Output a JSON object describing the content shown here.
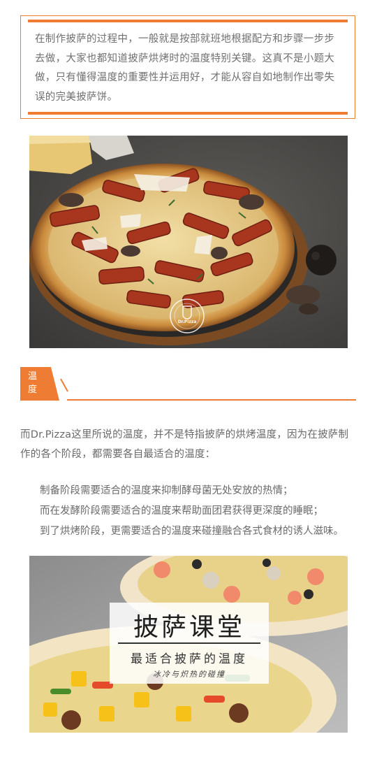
{
  "intro": {
    "text": "在制作披萨的过程中，一般就是按部就班地根据配方和步骤一步步去做，大家也都知道披萨烘烤时的温度特别关键。这真不是小题大做，只有懂得温度的重要性并运用好，才能从容自如地制作出零失误的完美披萨饼。"
  },
  "pizza_photo": {
    "watermark_text": "Dr.Pizza"
  },
  "section": {
    "tag": "温度"
  },
  "body": {
    "paragraph": "而Dr.Pizza这里所说的温度，并不是特指披萨的烘烤温度，因为在披萨制作的各个阶段，都需要各自最适合的温度：",
    "points": [
      "制备阶段需要适合的温度来抑制酵母菌无处安放的热情；",
      "而在发酵阶段需要适合的温度来帮助面团君获得更深度的睡眠；",
      "到了烘烤阶段，更需要适合的温度来碰撞融合各式食材的诱人滋味。"
    ]
  },
  "class_card": {
    "title": "披萨课堂",
    "subtitle": "最适合披萨的温度",
    "tagline": "冰冷与炽热的碰撞"
  },
  "colors": {
    "accent": "#ee7d33"
  }
}
